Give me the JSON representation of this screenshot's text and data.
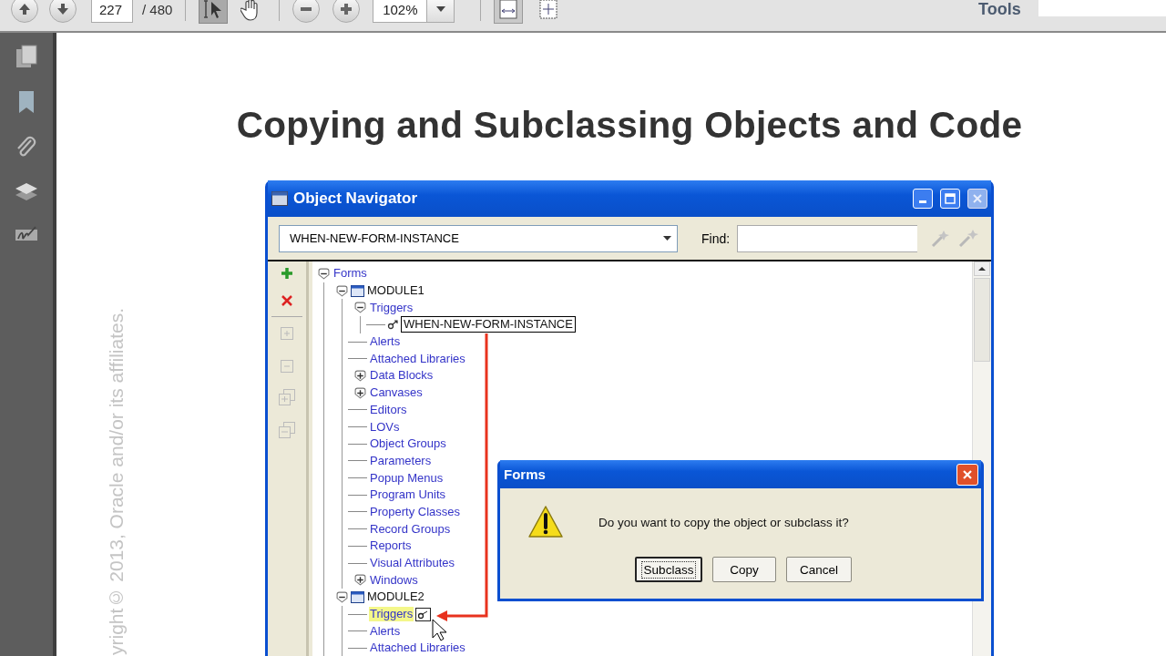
{
  "toolbar": {
    "page_number": "227",
    "page_count": "/ 480",
    "zoom": "102%",
    "select_tool_active": true,
    "tools_label": "Tools"
  },
  "document": {
    "copyright": "yright© 2013, Oracle and/or its affiliates.",
    "title": "Copying and Subclassing Objects and Code"
  },
  "object_navigator": {
    "title": "Object Navigator",
    "combo_value": "WHEN-NEW-FORM-INSTANCE",
    "find_label": "Find:",
    "tree": [
      {
        "label": "Forms",
        "kind": "folder",
        "expanded": true,
        "children": [
          {
            "label": "MODULE1",
            "kind": "module",
            "expanded": true,
            "children": [
              {
                "label": "Triggers",
                "kind": "folder",
                "expanded": true,
                "children": [
                  {
                    "label": "WHEN-NEW-FORM-INSTANCE",
                    "kind": "trigger",
                    "focused": true
                  }
                ]
              },
              {
                "label": "Alerts",
                "kind": "leaf"
              },
              {
                "label": "Attached Libraries",
                "kind": "leaf"
              },
              {
                "label": "Data Blocks",
                "kind": "folder",
                "expanded": false
              },
              {
                "label": "Canvases",
                "kind": "folder",
                "expanded": false
              },
              {
                "label": "Editors",
                "kind": "leaf"
              },
              {
                "label": "LOVs",
                "kind": "leaf"
              },
              {
                "label": "Object Groups",
                "kind": "leaf"
              },
              {
                "label": "Parameters",
                "kind": "leaf"
              },
              {
                "label": "Popup Menus",
                "kind": "leaf"
              },
              {
                "label": "Program Units",
                "kind": "leaf"
              },
              {
                "label": "Property Classes",
                "kind": "leaf"
              },
              {
                "label": "Record Groups",
                "kind": "leaf"
              },
              {
                "label": "Reports",
                "kind": "leaf"
              },
              {
                "label": "Visual Attributes",
                "kind": "leaf"
              },
              {
                "label": "Windows",
                "kind": "folder",
                "expanded": false
              }
            ]
          },
          {
            "label": "MODULE2",
            "kind": "module",
            "expanded": true,
            "children": [
              {
                "label": "Triggers",
                "kind": "leaf",
                "drop_target": true
              },
              {
                "label": "Alerts",
                "kind": "leaf"
              },
              {
                "label": "Attached Libraries",
                "kind": "leaf"
              }
            ]
          }
        ]
      }
    ]
  },
  "dialog": {
    "title": "Forms",
    "message": "Do you want to copy the object or subclass it?",
    "buttons": [
      {
        "label": "Subclass",
        "default": true
      },
      {
        "label": "Copy",
        "default": false
      },
      {
        "label": "Cancel",
        "default": false
      }
    ]
  }
}
